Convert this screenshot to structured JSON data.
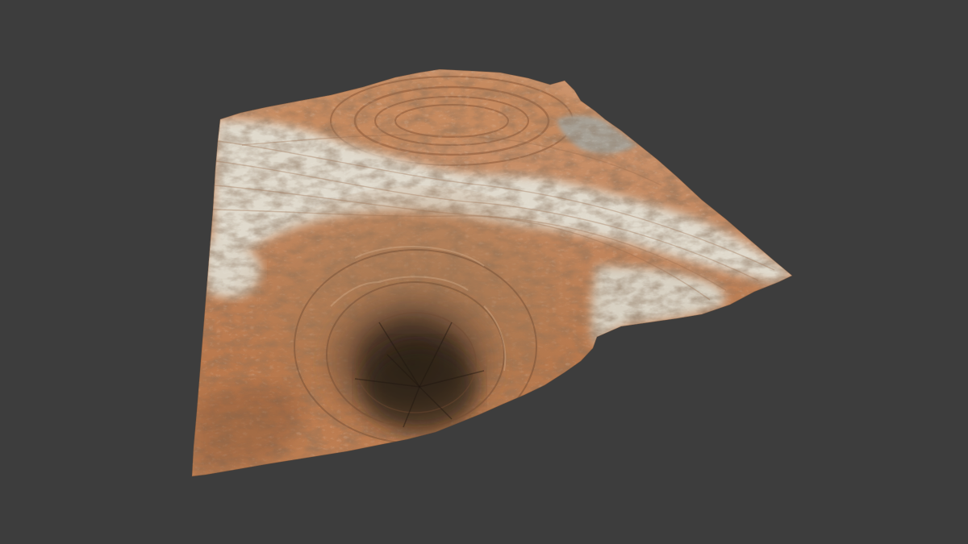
{
  "scene": {
    "background_color": "#3d3d3d",
    "object": "terrain-relief-model",
    "palette": {
      "light_rock": "#e2ddd1",
      "pale_rock": "#cfc8b8",
      "tan_rock": "#d09a72",
      "orange_rock": "#c9875c",
      "rust_rock": "#a8683f",
      "brown_rock": "#8a5a3a",
      "dark_brown": "#4a3324",
      "shadow": "#2f241c",
      "grey_patch": "#a7a196"
    }
  }
}
